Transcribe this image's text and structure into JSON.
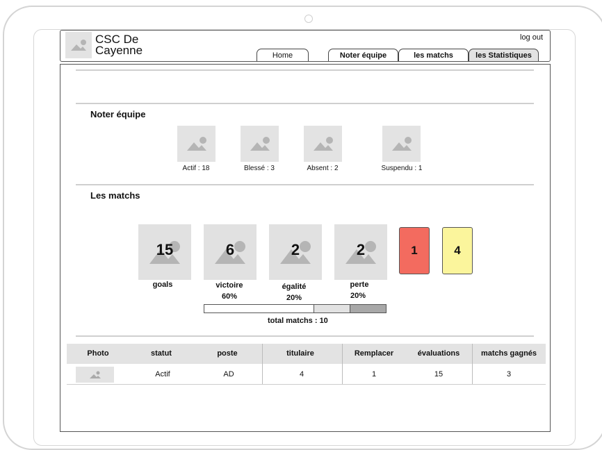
{
  "header": {
    "title": "CSC De Cayenne",
    "logout": "log out",
    "tabs": [
      {
        "label": "Home",
        "active": false
      },
      {
        "label": "Noter équipe",
        "active": false
      },
      {
        "label": "les matchs",
        "active": false
      },
      {
        "label": "les Statistiques",
        "active": true
      }
    ]
  },
  "noter_equipe": {
    "title": "Noter équipe",
    "stats": [
      "Actif : 18",
      "Blessé : 3",
      "Absent : 2",
      "Suspendu : 1"
    ]
  },
  "les_matchs": {
    "title": "Les matchs",
    "cards": [
      {
        "value": "15",
        "label": "goals",
        "percent": ""
      },
      {
        "value": "6",
        "label": "victoire",
        "percent": "60%"
      },
      {
        "value": "2",
        "label": "égalité",
        "percent": "20%"
      },
      {
        "value": "2",
        "label": "perte",
        "percent": "20%"
      }
    ],
    "red_card": "1",
    "yellow_card": "4",
    "red_color": "#f36b5f",
    "yellow_color": "#fbf59c",
    "progress": [
      {
        "fraction": 0.6,
        "color": "#ffffff"
      },
      {
        "fraction": 0.2,
        "color": "#e2e2e2"
      },
      {
        "fraction": 0.2,
        "color": "#a8a8a8"
      }
    ],
    "total": "total matchs : 10"
  },
  "table": {
    "headers": [
      "Photo",
      "statut",
      "poste",
      "titulaire",
      "Remplacer",
      "évaluations",
      "matchs gagnés"
    ],
    "rows": [
      {
        "statut": "Actif",
        "poste": "AD",
        "titulaire": "4",
        "remplacer": "1",
        "evaluations": "15",
        "matchs_gagnes": "3"
      }
    ]
  }
}
